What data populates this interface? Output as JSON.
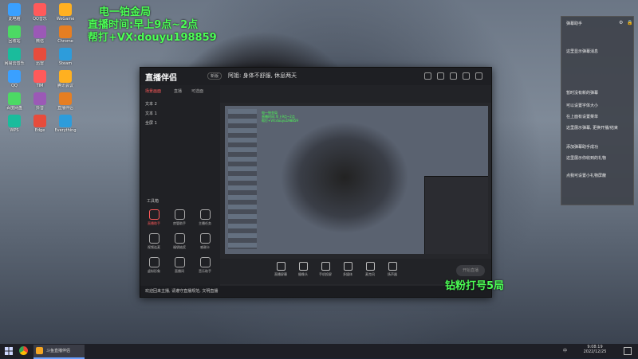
{
  "overlay": {
    "line1": "电一铂金局",
    "line2": "直播时间:早上9点~2点",
    "line3": "帮打+VX:douyu198859",
    "fan_badge": "钻粉打号5局"
  },
  "app": {
    "name": "直播伴侣",
    "version": "新版",
    "notice": "阿姐: 身体不舒服, 休息两天",
    "left_tabs": [
      "场景画面",
      "直播",
      "可选面"
    ],
    "scenes": [
      "文本 2",
      "文本 1",
      "全屏 1"
    ],
    "tools_header": "工具箱",
    "tools": [
      "直播助手",
      "房管助手",
      "主播任务",
      "视频连麦",
      "福袋抽奖",
      "感谢卡",
      "虚拟形象",
      "直播间",
      "音乐助手"
    ],
    "bottom_buttons": [
      "直播屏幕",
      "摄像头",
      "手机投屏",
      "多媒体",
      "麦克风",
      "扬声器"
    ],
    "start_button": "开始直播",
    "status_text": "欢迎回来主播, 请遵守直播规范, 文明直播"
  },
  "chat": {
    "title": "弹幕助手",
    "lines": [
      "这里显示弹幕消息",
      "暂时没有新的弹幕",
      "可以设置字体大小",
      "在上面有设置菜单",
      "这里展示弹幕, 更换开播/结束",
      "添加弹幕助手成功",
      "这里展示你收到的礼物",
      "点我可设置小礼物屏蔽"
    ]
  },
  "desktop_icons": [
    "此电脑",
    "QQ音乐",
    "WeGame",
    "回收站",
    "微信",
    "Chrome",
    "网易云音乐",
    "迅雷",
    "Steam",
    "QQ",
    "TIM",
    "腾讯会议",
    "百度网盘",
    "抖音",
    "直播伴侣",
    "WPS",
    "Edge",
    "Everything"
  ],
  "taskbar": {
    "active_app": "斗鱼直播伴侣",
    "time": "9:08:19",
    "date": "2022/12/25",
    "lang": "中"
  },
  "colors": {
    "overlay_green": "#4cff55",
    "accent_red": "#ff5a5a",
    "window_bg": "#26272b"
  }
}
